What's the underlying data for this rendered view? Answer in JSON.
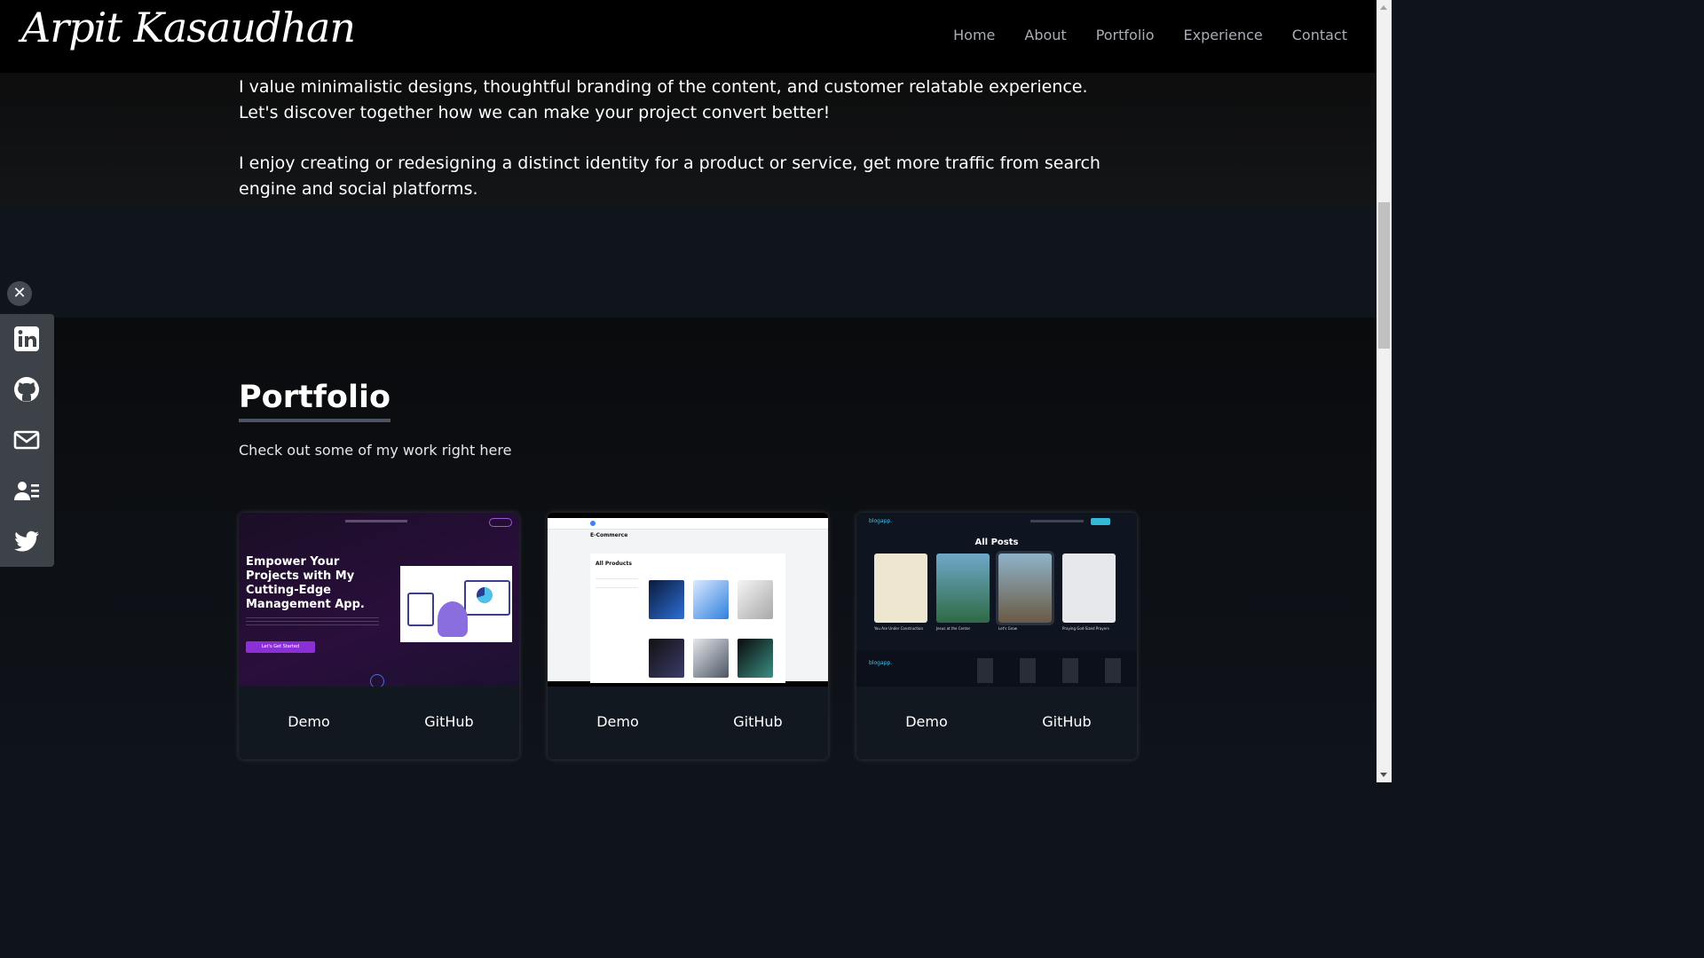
{
  "header": {
    "logo": "Arpit Kasaudhan",
    "nav": [
      "Home",
      "About",
      "Portfolio",
      "Experience",
      "Contact"
    ]
  },
  "about": {
    "paragraph1": "I value minimalistic designs, thoughtful branding of the content, and customer relatable experience. Let's discover together how we can make your project convert better!",
    "paragraph2": "I enjoy creating or redesigning a distinct identity for a product or service, get more traffic from search engine and social platforms."
  },
  "portfolio": {
    "title": "Portfolio",
    "subtitle": "Check out some of my work right here",
    "cards": [
      {
        "demo_label": "Demo",
        "github_label": "GitHub",
        "thumb": {
          "headline": "Empower Your Projects with My Cutting-Edge Management App.",
          "cta": "Let's Get Started"
        }
      },
      {
        "demo_label": "Demo",
        "github_label": "GitHub",
        "thumb": {
          "title": "E-Commerce",
          "heading": "All Products"
        }
      },
      {
        "demo_label": "Demo",
        "github_label": "GitHub",
        "thumb": {
          "brand": "blogapp.",
          "heading": "All Posts",
          "posts": [
            "You Are Under Construction",
            "Jesus at the Center",
            "Let's Grow",
            "Praying God-Sized Prayers"
          ],
          "footer_brand": "blogapp."
        }
      }
    ]
  },
  "sidebar": {
    "close_icon": "close-icon",
    "icons": [
      "linkedin-icon",
      "github-icon",
      "mail-icon",
      "resume-icon",
      "twitter-icon"
    ]
  },
  "colors": {
    "header_bg": "#000000",
    "page_bg": "#0f141b",
    "nav_text": "#a9aeb6",
    "sidebar_bg": "#3d4249",
    "accent_purple": "#8b2fd6",
    "accent_cyan": "#35b8d8"
  }
}
